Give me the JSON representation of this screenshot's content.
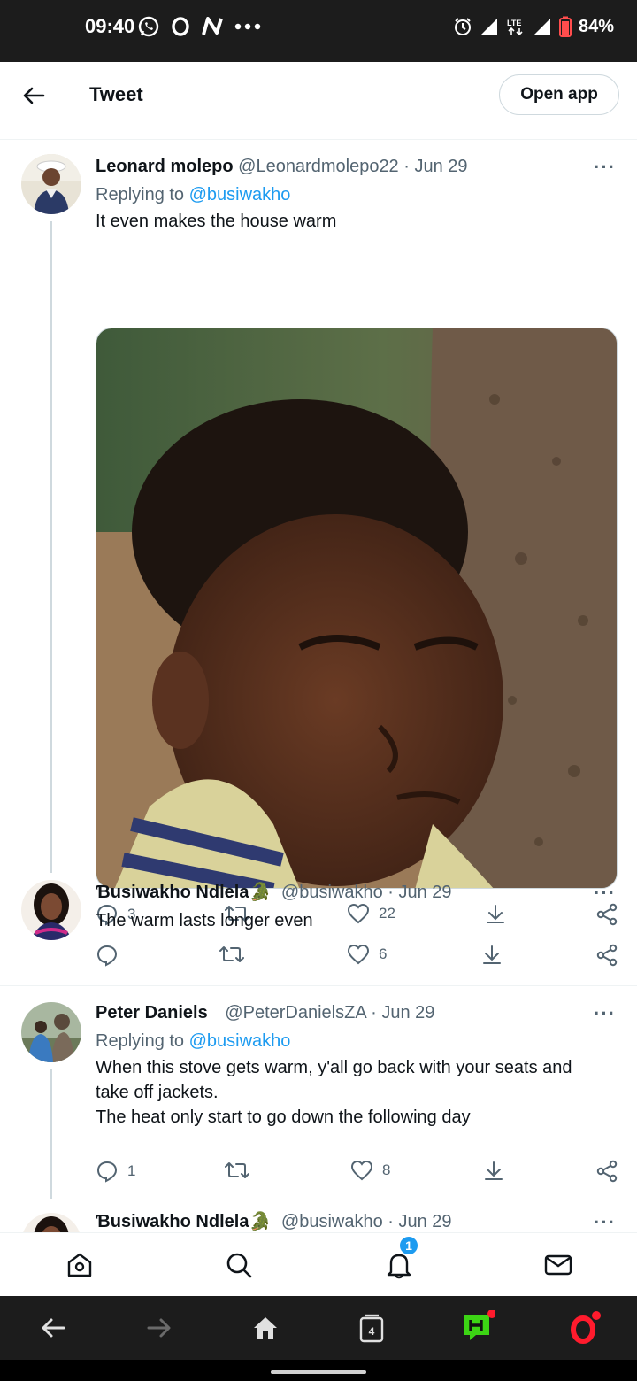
{
  "status_bar": {
    "time": "09:40",
    "battery": "84%",
    "network": "LTE",
    "left_icons": [
      "whatsapp-icon",
      "opera-icon",
      "nfc-icon",
      "more-dots-icon"
    ],
    "right_icons": [
      "alarm-icon",
      "signal-icon",
      "lte-icon",
      "signal-icon",
      "battery-icon"
    ]
  },
  "header": {
    "title": "Tweet",
    "open_app_label": "Open app"
  },
  "tweets": [
    {
      "name": "Leonard molepo",
      "handle": "@Leonardmolepo22",
      "date": "· Jun 29",
      "replying_label": "Replying to ",
      "replying_to": "@busiwakho",
      "text": "It even makes the house warm",
      "replies": "3",
      "retweets": "",
      "likes": "22",
      "has_media": true
    },
    {
      "name": "Ɓusiwakho Ndlela",
      "name_emoji": "🐊",
      "handle": "@busiwakho",
      "date": "· Jun 29",
      "text": "The warm lasts longer even",
      "replies": "",
      "retweets": "",
      "likes": "6"
    },
    {
      "name": "Peter Daniels",
      "handle": "@PeterDanielsZA",
      "date": "· Jun 29",
      "replying_label": "Replying to ",
      "replying_to": "@busiwakho",
      "text_lines": [
        "When this stove gets warm, y'all go back with your seats and",
        "take off jackets.",
        "The heat only start to go down the following day"
      ],
      "replies": "1",
      "retweets": "",
      "likes": "8"
    },
    {
      "name": "Ɓusiwakho Ndlela",
      "name_emoji": "🐊",
      "handle": "@busiwakho",
      "date": "· Jun 29"
    }
  ],
  "more_label": "···",
  "bottom_nav": {
    "items": [
      "home-icon",
      "search-icon",
      "notifications-icon",
      "messages-icon"
    ],
    "notification_count": "1"
  },
  "browser_bar": {
    "tab_count": "4",
    "items": [
      "back-icon",
      "forward-icon",
      "home-icon",
      "tabs-icon",
      "hype-icon",
      "opera-menu-icon"
    ]
  },
  "colors": {
    "accent": "#1d9bf0",
    "text": "#0f1419",
    "muted": "#536471",
    "opera_red": "#ff1b2d",
    "hype_green": "#3cd414"
  }
}
